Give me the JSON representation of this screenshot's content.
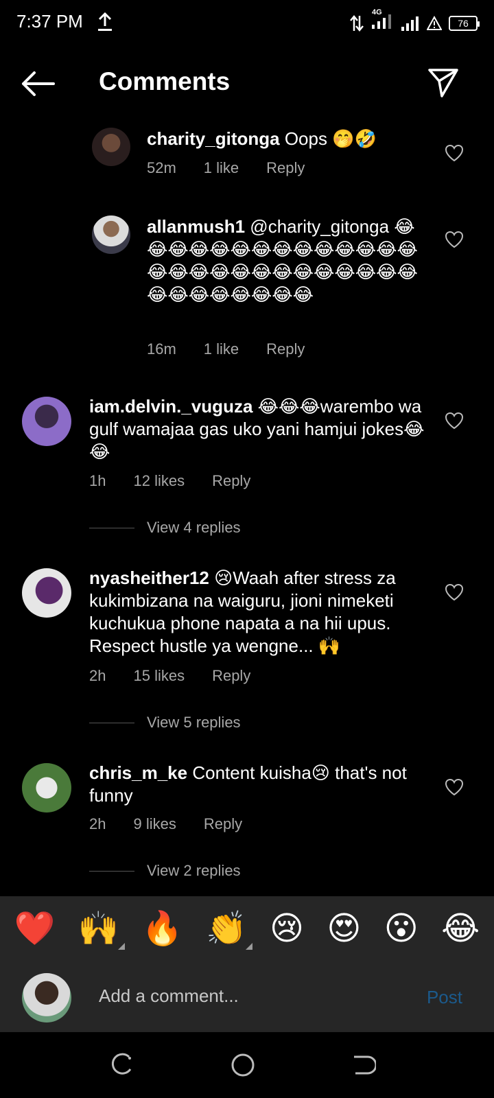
{
  "status": {
    "time": "7:37 PM",
    "network": "4G",
    "battery": "76"
  },
  "header": {
    "title": "Comments"
  },
  "comments": [
    {
      "user": "charity_gitonga",
      "text": "Oops 🤭🤣",
      "time": "52m",
      "likes": "1 like",
      "reply": "Reply"
    },
    {
      "user": "allanmush1",
      "text": "@charity_gitonga 😂😂😂😂😂😂😂😂😂😂😂😂😂😂😂😂😂😂😂😂😂😂😂😂😂😂😂😂😂😂😂😂😂😂😂",
      "time": "16m",
      "likes": "1 like",
      "reply": "Reply"
    },
    {
      "user": "iam.delvin._vuguza",
      "text": "😂😂😂warembo wa gulf wamajaa gas uko yani hamjui jokes😂😂",
      "time": "1h",
      "likes": "12 likes",
      "reply": "Reply",
      "view_replies": "View 4 replies"
    },
    {
      "user": "nyasheither12",
      "text": "😢Waah after stress za kukimbizana na waiguru, jioni nimeketi kuchukua phone napata a na hii upus. Respect hustle ya wengne... 🙌",
      "time": "2h",
      "likes": "15 likes",
      "reply": "Reply",
      "view_replies": "View 5 replies"
    },
    {
      "user": "chris_m_ke",
      "text": "Content kuisha😢 that's not funny",
      "time": "2h",
      "likes": "9 likes",
      "reply": "Reply",
      "view_replies": "View 2 replies"
    }
  ],
  "emoji_bar": [
    "❤️",
    "🙌",
    "🔥",
    "👏",
    "😢",
    "😍",
    "😮",
    "😂"
  ],
  "compose": {
    "placeholder": "Add a comment...",
    "post_label": "Post"
  },
  "colors": {
    "background": "#000000",
    "secondary_text": "#a8a8a8",
    "post_disabled": "#1b5a8c",
    "bar": "#262626"
  }
}
